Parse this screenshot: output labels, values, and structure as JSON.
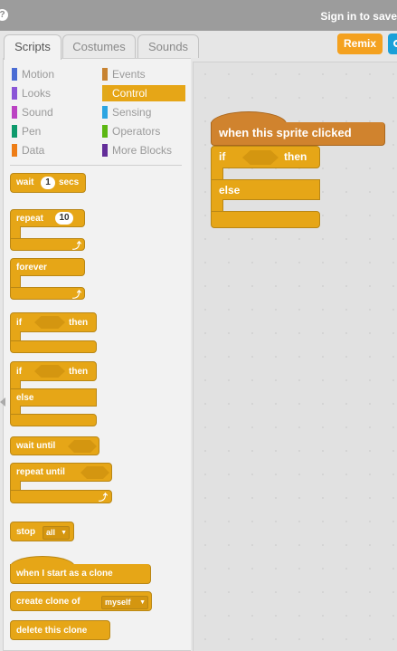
{
  "header": {
    "help_icon": "?",
    "signin": "Sign in to save"
  },
  "tabs": [
    "Scripts",
    "Costumes",
    "Sounds"
  ],
  "remix_label": "Remix",
  "categories": [
    {
      "label": "Motion",
      "color": "#4a6cd4"
    },
    {
      "label": "Looks",
      "color": "#8a55d7"
    },
    {
      "label": "Sound",
      "color": "#bb42c3"
    },
    {
      "label": "Pen",
      "color": "#0e9a6c"
    },
    {
      "label": "Data",
      "color": "#ee7d16"
    },
    {
      "label": "Events",
      "color": "#c88330"
    },
    {
      "label": "Control",
      "color": "#e1a91a"
    },
    {
      "label": "Sensing",
      "color": "#2ca5e2"
    },
    {
      "label": "Operators",
      "color": "#5cb712"
    },
    {
      "label": "More Blocks",
      "color": "#632d99"
    }
  ],
  "palette_blocks": {
    "wait": "wait",
    "wait_value": "1",
    "secs": "secs",
    "repeat": "repeat",
    "repeat_value": "10",
    "forever": "forever",
    "if": "if",
    "then": "then",
    "if2": "if",
    "then2": "then",
    "else": "else",
    "wait_until": "wait until",
    "repeat_until": "repeat until",
    "stop": "stop",
    "stop_value": "all",
    "when_clone": "when I start as a clone",
    "create_clone": "create clone of",
    "create_clone_value": "myself",
    "delete_clone": "delete this clone"
  },
  "script": {
    "hat": "when this sprite clicked",
    "if": "if",
    "then": "then",
    "else": "else"
  }
}
